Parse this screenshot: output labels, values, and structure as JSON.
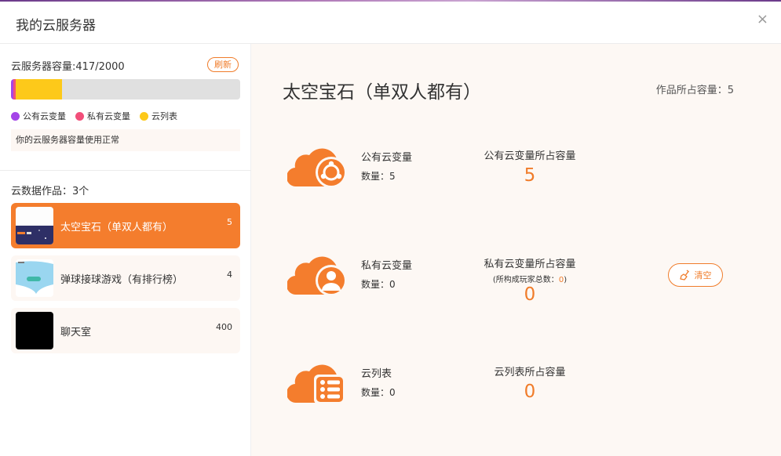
{
  "dialog": {
    "title": "我的云服务器",
    "close_glyph": "×"
  },
  "sidebar": {
    "capacity_label": "云服务器容量:417/2000",
    "refresh_label": "刷新",
    "usage": {
      "used": 417,
      "total": 2000,
      "segments": [
        {
          "name": "公有云变量",
          "value": 5,
          "color": "#a445e8"
        },
        {
          "name": "私有云变量",
          "value": 8,
          "color": "#f24f7a"
        },
        {
          "name": "云列表",
          "value": 404,
          "color": "#fdc91a"
        }
      ]
    },
    "legend": [
      {
        "label": "公有云变量",
        "color": "#a445e8"
      },
      {
        "label": "私有云变量",
        "color": "#f24f7a"
      },
      {
        "label": "云列表",
        "color": "#fdc91a"
      }
    ],
    "notice": "你的云服务器容量使用正常",
    "works_label": "云数据作品：3个",
    "works": [
      {
        "name": "太空宝石（单双人都有）",
        "count": "5"
      },
      {
        "name": "弹球接球游戏（有排行榜）",
        "count": "4"
      },
      {
        "name": "聊天室",
        "count": "400"
      }
    ]
  },
  "main": {
    "project_title": "太空宝石（单双人都有）",
    "project_capacity": "作品所占容量：5",
    "sections": [
      {
        "label": "公有云变量",
        "count": "数量：5",
        "cap_label": "公有云变量所占容量",
        "cap_value": "5",
        "icon": "cloud-public-variable-icon"
      },
      {
        "label": "私有云变量",
        "count": "数量：0",
        "cap_label": "私有云变量所占容量",
        "cap_sub_prefix": "(所构成玩家总数：",
        "cap_sub_value": "0",
        "cap_sub_suffix": ")",
        "cap_value": "0",
        "icon": "cloud-private-variable-icon",
        "clear_label": "清空"
      },
      {
        "label": "云列表",
        "count": "数量：0",
        "cap_label": "云列表所占容量",
        "cap_value": "0",
        "icon": "cloud-list-icon"
      }
    ]
  },
  "colors": {
    "accent": "#f47d2d"
  }
}
